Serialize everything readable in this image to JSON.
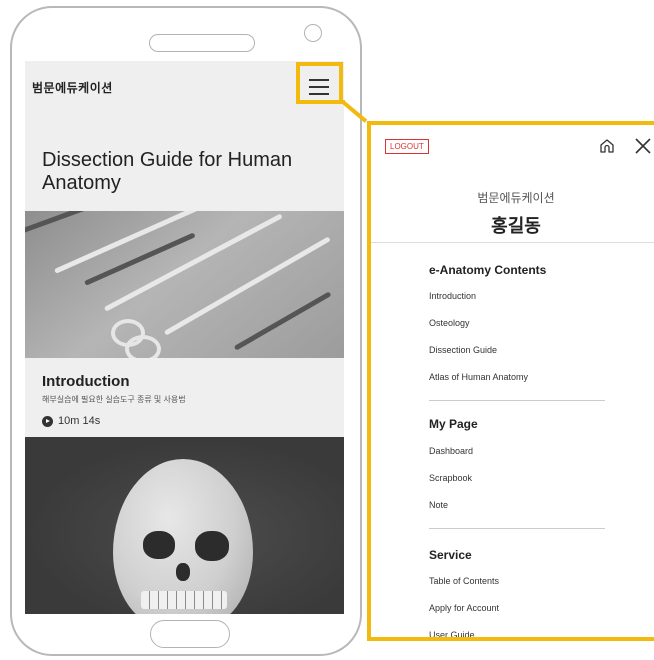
{
  "app": {
    "brand": "범문에듀케이션",
    "hero_title": "Dissection Guide for Human Anatomy"
  },
  "card": {
    "title": "Introduction",
    "subtitle": "해부실습에 필요한 실습도구 종류 및 사용법",
    "duration": "10m 14s"
  },
  "menu": {
    "logout_label": "LOGOUT",
    "org": "범문에듀케이션",
    "user_name": "홍길동",
    "sections": [
      {
        "title": "e-Anatomy Contents",
        "items": [
          "Introduction",
          "Osteology",
          "Dissection Guide",
          "Atlas of Human Anatomy"
        ]
      },
      {
        "title": "My Page",
        "items": [
          "Dashboard",
          "Scrapbook",
          "Note"
        ]
      },
      {
        "title": "Service",
        "items": [
          "Table of Contents",
          "Apply for Account",
          "User Guide"
        ]
      }
    ]
  },
  "colors": {
    "highlight": "#f2b90f",
    "logout": "#dd3333"
  },
  "icons": {
    "menu": "hamburger-icon",
    "home": "home-icon",
    "close": "close-icon",
    "play": "play-icon"
  }
}
